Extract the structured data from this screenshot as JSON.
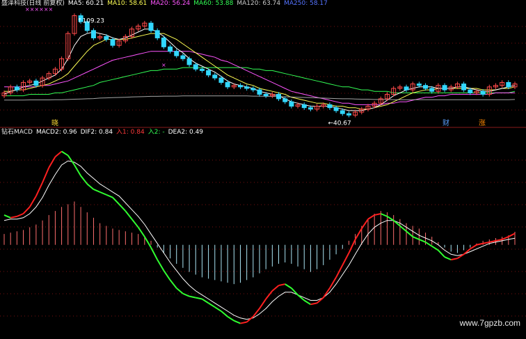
{
  "colors": {
    "up": "#ff4a4a",
    "down": "#32d8ff",
    "ma5": "#ffffff",
    "ma10": "#ffff55",
    "ma20": "#ff55ff",
    "ma60": "#33ff55",
    "ma120": "#a5a5a5",
    "ma250": "#5573ff",
    "macd_up": "#ff6e6e",
    "macd_down": "#aae6f5",
    "dif_rise": "#ff2020",
    "dif_fall": "#30ff30",
    "dea": "#ffffff",
    "divider": "#8a1a1a",
    "grid": "#7a1010"
  },
  "main_legend": {
    "title": "盛泽科技(日线 前复权)",
    "ma5": "MA5: 60.21",
    "ma10": "MA10: 58.61",
    "ma20": "MA20: 56.24",
    "ma60": "MA60: 53.88",
    "ma120": "MA120: 63.74",
    "ma250": "MA250: 58.17"
  },
  "annotations": {
    "high": "109.23",
    "low": "40.67",
    "top_marks": "××××××",
    "ba": "×",
    "marker_1": "晓",
    "marker_2": "财",
    "marker_3": "涨"
  },
  "sub_legend": {
    "title": "钻石MACD",
    "macd2": "MACD2: 0.96",
    "dif2": "DIF2: 0.84",
    "in1": "入1: 0.84",
    "in2": "入2: -",
    "dea2": "DEA2: 0.49"
  },
  "watermark": "www.7gpzb.com",
  "chart_data": {
    "type": "line",
    "price": {
      "high": 109.23,
      "low": 40.67,
      "close": [
        56,
        60,
        58,
        63,
        64,
        61,
        66,
        69,
        72,
        79,
        96,
        108,
        104,
        98,
        93,
        94,
        92,
        88,
        91,
        94,
        99,
        101,
        103,
        98,
        93,
        87,
        84,
        81,
        79,
        75,
        72,
        71,
        68,
        66,
        63,
        60,
        61,
        60,
        59,
        58,
        55,
        54,
        55,
        52,
        50,
        47,
        48,
        46,
        45,
        47,
        48,
        46,
        44,
        42,
        41,
        43,
        45,
        47,
        49,
        52,
        55,
        59,
        60,
        58,
        62,
        61,
        59,
        57,
        61,
        58,
        60,
        62,
        58,
        56,
        57,
        55,
        60,
        61,
        63,
        60,
        62
      ],
      "ma_fast": [
        55,
        57,
        58,
        60,
        61,
        62,
        64,
        66,
        68,
        72,
        79,
        88,
        94,
        96,
        97,
        96,
        95,
        93,
        92,
        93,
        95,
        97,
        99,
        99,
        97,
        94,
        90,
        86,
        83,
        79,
        76,
        74,
        72,
        70,
        67,
        64,
        62,
        61,
        60,
        59,
        57,
        56,
        55,
        54,
        52,
        50,
        49,
        48,
        47,
        47,
        47,
        47,
        46,
        45,
        44,
        44,
        44,
        45,
        46,
        48,
        51,
        54,
        56,
        58,
        59,
        60,
        60,
        60,
        59,
        59,
        59,
        60,
        60,
        59,
        58,
        57,
        57,
        58,
        59,
        60,
        61
      ],
      "ma_mid": [
        57,
        57,
        58,
        58,
        59,
        60,
        61,
        62,
        64,
        66,
        69,
        74,
        79,
        84,
        88,
        90,
        92,
        92,
        92,
        92,
        93,
        94,
        95,
        96,
        96,
        96,
        94,
        92,
        89,
        86,
        83,
        80,
        77,
        74,
        71,
        68,
        66,
        64,
        62,
        61,
        59,
        58,
        57,
        56,
        55,
        53,
        52,
        51,
        50,
        49,
        49,
        48,
        47,
        47,
        46,
        46,
        45,
        45,
        46,
        47,
        48,
        50,
        52,
        54,
        56,
        57,
        58,
        58,
        59,
        59,
        59,
        59,
        59,
        59,
        59,
        58,
        58,
        58,
        59,
        59,
        60
      ],
      "ma_slow": [
        60,
        60,
        60,
        60,
        60,
        60,
        61,
        61,
        62,
        63,
        64,
        66,
        68,
        70,
        72,
        74,
        76,
        78,
        79,
        80,
        81,
        82,
        83,
        84,
        84,
        84,
        84,
        84,
        84,
        84,
        83,
        82,
        81,
        80,
        78,
        77,
        75,
        73,
        71,
        69,
        67,
        65,
        63,
        61,
        59,
        57,
        56,
        55,
        54,
        53,
        52,
        51,
        50,
        49,
        49,
        48,
        48,
        48,
        48,
        48,
        49,
        49,
        50,
        50,
        51,
        52,
        53,
        53,
        54,
        54,
        55,
        55,
        55,
        55,
        55,
        55,
        55,
        56,
        56,
        56,
        56
      ],
      "ma_long": [
        54,
        54,
        54,
        54,
        55,
        55,
        55,
        55,
        56,
        56,
        57,
        58,
        59,
        60,
        61,
        63,
        64,
        65,
        66,
        67,
        68,
        69,
        70,
        71,
        71,
        72,
        72,
        72,
        73,
        73,
        73,
        73,
        73,
        73,
        73,
        73,
        73,
        73,
        73,
        72,
        72,
        71,
        71,
        70,
        69,
        68,
        67,
        66,
        65,
        64,
        63,
        62,
        61,
        60,
        60,
        59,
        58,
        58,
        57,
        57,
        57,
        56,
        56,
        56,
        56,
        56,
        56,
        56,
        56,
        56,
        56,
        56,
        56,
        56,
        56,
        56,
        56,
        56,
        56,
        56,
        57
      ]
    },
    "macd": {
      "hist": [
        0.8,
        0.9,
        1.0,
        1.1,
        1.3,
        1.5,
        1.8,
        2.2,
        2.5,
        2.8,
        3.0,
        3.2,
        2.8,
        2.4,
        2.0,
        1.6,
        1.4,
        1.2,
        1.1,
        1.0,
        0.9,
        0.8,
        0.6,
        0.3,
        -0.2,
        -0.6,
        -1.0,
        -1.4,
        -1.7,
        -2.0,
        -2.2,
        -2.4,
        -2.5,
        -2.6,
        -2.7,
        -2.8,
        -2.9,
        -2.8,
        -2.6,
        -2.4,
        -2.1,
        -1.8,
        -1.6,
        -1.4,
        -1.3,
        -1.4,
        -1.6,
        -1.8,
        -2.0,
        -1.8,
        -1.5,
        -1.1,
        -0.7,
        -0.3,
        0.3,
        0.8,
        1.4,
        1.9,
        2.3,
        2.5,
        2.4,
        2.2,
        1.9,
        1.6,
        1.4,
        1.2,
        0.9,
        0.6,
        0.2,
        -0.2,
        -0.5,
        -0.6,
        -0.4,
        -0.2,
        0.1,
        0.3,
        0.4,
        0.5,
        0.6,
        0.7,
        0.96
      ],
      "dif": [
        2.2,
        2.0,
        2.1,
        2.3,
        2.8,
        3.6,
        4.6,
        5.7,
        6.5,
        6.9,
        6.6,
        5.9,
        5.1,
        4.5,
        4.1,
        3.9,
        3.7,
        3.5,
        3.0,
        2.5,
        1.9,
        1.3,
        0.6,
        -0.2,
        -1.1,
        -1.9,
        -2.6,
        -3.2,
        -3.6,
        -3.8,
        -3.9,
        -4.0,
        -4.3,
        -4.6,
        -4.9,
        -5.3,
        -5.6,
        -5.8,
        -5.7,
        -5.3,
        -4.7,
        -4.0,
        -3.4,
        -3.0,
        -2.9,
        -3.2,
        -3.7,
        -4.1,
        -4.4,
        -4.3,
        -3.9,
        -3.2,
        -2.4,
        -1.5,
        -0.6,
        0.4,
        1.2,
        1.9,
        2.2,
        2.3,
        2.1,
        1.8,
        1.4,
        1.0,
        0.6,
        0.4,
        0.2,
        -0.1,
        -0.4,
        -0.9,
        -1.1,
        -1.0,
        -0.7,
        -0.3,
        0.0,
        0.1,
        0.2,
        0.3,
        0.4,
        0.6,
        0.84
      ],
      "dea": [
        1.8,
        1.9,
        1.9,
        2.0,
        2.3,
        2.8,
        3.5,
        4.4,
        5.2,
        5.9,
        6.2,
        6.1,
        5.8,
        5.3,
        4.9,
        4.5,
        4.2,
        3.9,
        3.6,
        3.1,
        2.6,
        2.1,
        1.5,
        0.8,
        0.1,
        -0.6,
        -1.3,
        -1.9,
        -2.5,
        -3.0,
        -3.4,
        -3.7,
        -4.0,
        -4.3,
        -4.6,
        -4.9,
        -5.2,
        -5.4,
        -5.5,
        -5.4,
        -5.1,
        -4.7,
        -4.2,
        -3.8,
        -3.5,
        -3.5,
        -3.7,
        -3.9,
        -4.1,
        -4.1,
        -3.9,
        -3.5,
        -2.9,
        -2.2,
        -1.5,
        -0.7,
        0.1,
        0.8,
        1.3,
        1.6,
        1.8,
        1.8,
        1.6,
        1.3,
        1.0,
        0.7,
        0.5,
        0.3,
        0.0,
        -0.4,
        -0.7,
        -0.8,
        -0.7,
        -0.5,
        -0.3,
        -0.1,
        0.1,
        0.2,
        0.3,
        0.4,
        0.49
      ]
    }
  }
}
